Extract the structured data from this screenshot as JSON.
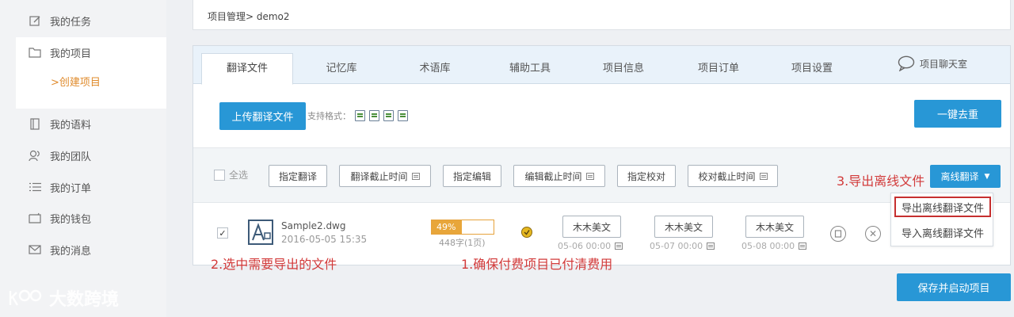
{
  "sidebar": {
    "items": [
      {
        "label": "我的任务",
        "icon": "edit-icon"
      },
      {
        "label": "我的项目",
        "icon": "folder-icon"
      },
      {
        "label": "我的语料",
        "icon": "book-icon"
      },
      {
        "label": "我的团队",
        "icon": "team-icon"
      },
      {
        "label": "我的订单",
        "icon": "list-icon"
      },
      {
        "label": "我的钱包",
        "icon": "wallet-icon"
      },
      {
        "label": "我的消息",
        "icon": "mail-icon"
      }
    ],
    "sub_item": ">创建项目",
    "watermark": "大数跨境"
  },
  "breadcrumb": "项目管理> demo2",
  "tabs": [
    "翻译文件",
    "记忆库",
    "术语库",
    "辅助工具",
    "项目信息",
    "项目订单",
    "项目设置"
  ],
  "chat_label": "项目聊天室",
  "upload_label": "上传翻译文件",
  "formats_label": "支持格式：",
  "dedupe_label": "一键去重",
  "toolbar": {
    "select_all": "全选",
    "buttons": [
      "指定翻译",
      "翻译截止时间",
      "指定编辑",
      "编辑截止时间",
      "指定校对",
      "校对截止时间"
    ],
    "offline_label": "离线翻译"
  },
  "dropdown": {
    "export": "导出离线翻译文件",
    "import": "导入离线翻译文件"
  },
  "file": {
    "name": "Sample2.dwg",
    "date": "2016-05-05 15:35",
    "progress_text": "49%",
    "progress": 0.49,
    "words": "448字(1页)",
    "assignees": [
      {
        "name": "木木美文",
        "due": "05-06 00:00"
      },
      {
        "name": "木木美文",
        "due": "05-07 00:00"
      },
      {
        "name": "木木美文",
        "due": "05-08 00:00"
      }
    ]
  },
  "save_label": "保存并启动项目",
  "annotations": {
    "note1": "1.确保付费项目已付清费用",
    "note2": "2.选中需要导出的文件",
    "note3": "3.导出离线文件"
  },
  "colors": {
    "accent": "#2897d6",
    "annotation": "#d23a3a",
    "progress": "#e8a63a"
  }
}
